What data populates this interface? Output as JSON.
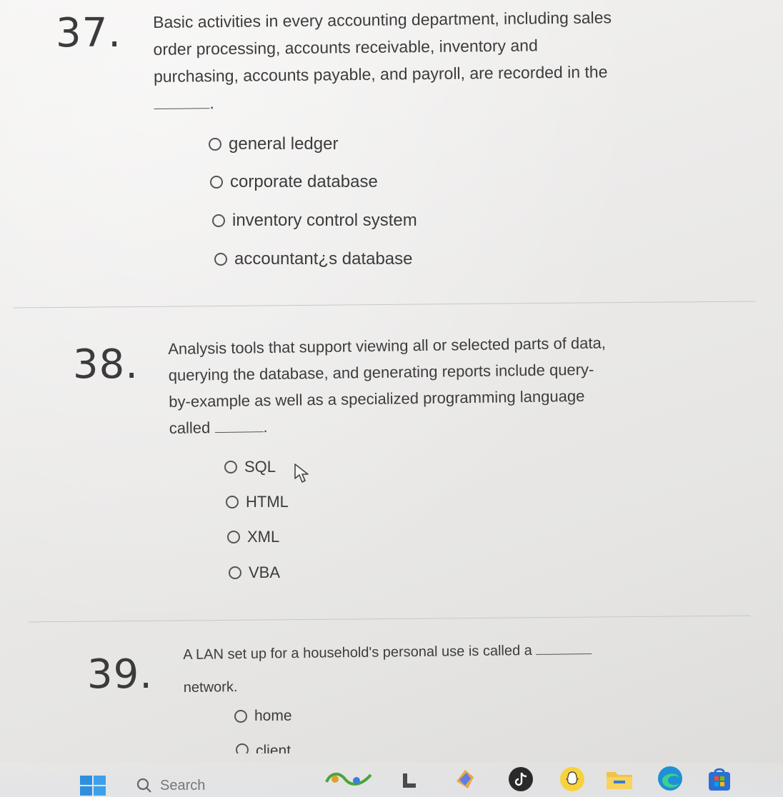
{
  "questions": [
    {
      "number": "37.",
      "lines": [
        "Basic activities in every accounting department, including sales",
        "order processing, accounts receivable, inventory and",
        "purchasing, accounts payable, and payroll, are recorded in the"
      ],
      "line4_end": ".",
      "options": [
        "general ledger",
        "corporate database",
        "inventory control system",
        "accountant¿s database"
      ]
    },
    {
      "number": "38.",
      "lines": [
        "Analysis tools that support viewing all or selected parts of data,",
        "querying the database, and generating reports include query-",
        "by-example as well as a specialized programming language"
      ],
      "line4_prefix": "called",
      "line4_end": ".",
      "options": [
        "SQL",
        "HTML",
        "XML",
        "VBA"
      ]
    },
    {
      "number": "39.",
      "lines": [
        "A LAN set up for a household's personal use is called a",
        "network."
      ],
      "options": [
        "home",
        "client"
      ]
    }
  ],
  "taskbar": {
    "search_label": "Search",
    "icons": [
      "windows-start-icon",
      "search-icon",
      "widgets-icon",
      "app-l-icon",
      "colorful-app-icon",
      "tiktok-icon",
      "snapchat-icon",
      "file-explorer-icon",
      "edge-icon",
      "microsoft-store-icon"
    ]
  }
}
